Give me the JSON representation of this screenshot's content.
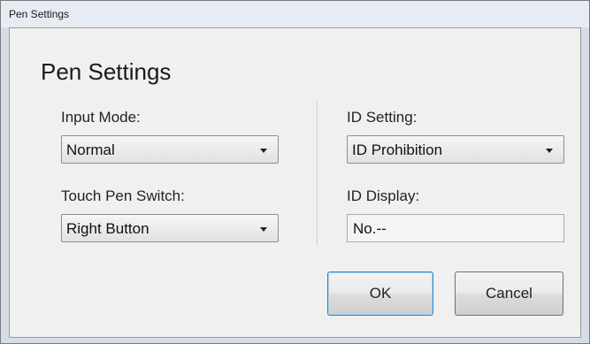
{
  "window": {
    "title": "Pen Settings"
  },
  "dialog": {
    "heading": "Pen Settings",
    "input_mode": {
      "label": "Input Mode:",
      "value": "Normal"
    },
    "touch_pen_switch": {
      "label": "Touch Pen Switch:",
      "value": "Right Button"
    },
    "id_setting": {
      "label": "ID Setting:",
      "value": "ID Prohibition"
    },
    "id_display": {
      "label": "ID Display:",
      "value": "No.--"
    },
    "buttons": {
      "ok": "OK",
      "cancel": "Cancel"
    }
  },
  "icons": {
    "dropdown": "chevron-down-icon"
  }
}
